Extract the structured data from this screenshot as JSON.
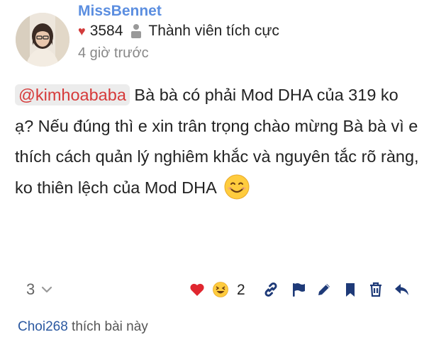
{
  "post": {
    "username": "MissBennet",
    "likes": "3584",
    "title_badge": "Thành viên tích cực",
    "time": "4 giờ trước",
    "mention": "@kimhoababa",
    "text": " Bà bà có phải Mod DHA của 319 ko ạ? Nếu đúng thì e xin trân trọng chào mừng Bà bà vì e thích cách quản lý nghiêm khắc và nguyên tắc rõ ràng, ko thiên lệch của Mod DHA"
  },
  "actions": {
    "reply_count": "3",
    "reaction_count": "2",
    "icons": [
      "heart-icon",
      "laughing-emoji-icon",
      "link-icon",
      "flag-icon",
      "edit-icon",
      "bookmark-icon",
      "delete-icon",
      "reply-icon"
    ]
  },
  "liked_by": {
    "user": "Choi268",
    "suffix": " thích bài này"
  },
  "colors": {
    "username": "#5b8ee0",
    "mention": "#d63a3a",
    "icon": "#1e3a78",
    "heart": "#d23b3b"
  }
}
